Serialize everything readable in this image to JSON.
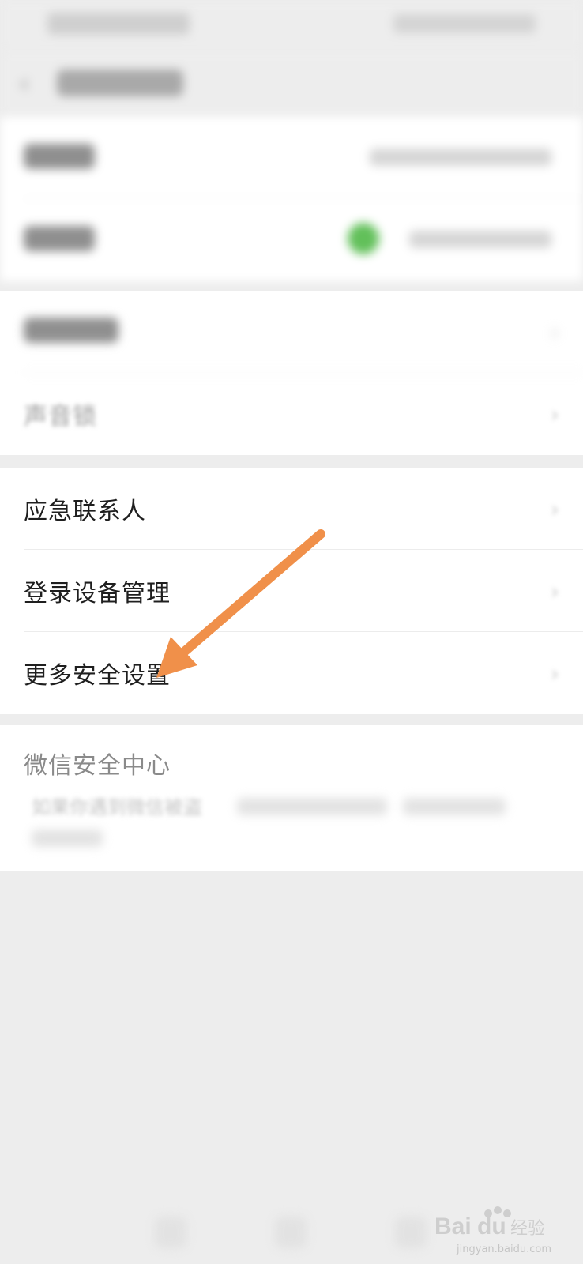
{
  "settings": {
    "group3": {
      "emergency_contact": "应急联系人",
      "device_manager": "登录设备管理",
      "more_security": "更多安全设置"
    },
    "group2": {
      "voice_lock": "声音锁"
    },
    "security_center": {
      "title": "微信安全中心",
      "description": "如果你遇到微信被盗"
    }
  },
  "annotation": {
    "arrow_color": "#f0904a"
  },
  "watermark": {
    "text": "jingyan.baidu.com"
  },
  "icons": {
    "back": "back-arrow-icon",
    "chevron": "chevron-right-icon",
    "status_dot": "green-status-icon"
  }
}
